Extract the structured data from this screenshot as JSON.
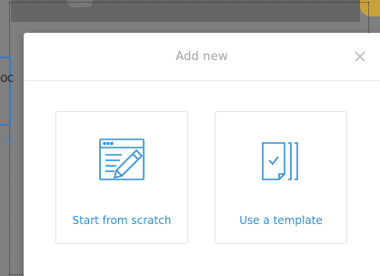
{
  "modal": {
    "title": "Add new",
    "close_icon": "close-icon",
    "options": [
      {
        "label": "Start from scratch",
        "icon": "edit-document-icon"
      },
      {
        "label": "Use a template",
        "icon": "template-documents-icon"
      }
    ]
  },
  "background": {
    "partial_text": "oc"
  },
  "colors": {
    "accent": "#2f8fd8",
    "title_text": "#a3a3a3",
    "overlay": "#7f7f7f"
  }
}
